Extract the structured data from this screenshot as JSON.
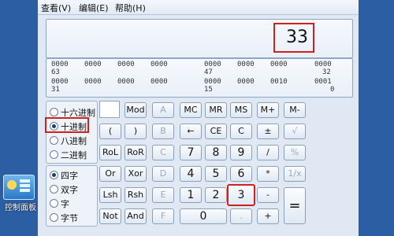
{
  "menu": {
    "view": "查看(V)",
    "edit": "编辑(E)",
    "help": "帮助(H)"
  },
  "display": {
    "value": "33"
  },
  "bits": {
    "r1": [
      "0000",
      "0000",
      "0000",
      "0000",
      "0000",
      "0000",
      "0000",
      "0000"
    ],
    "r2": [
      "63",
      "47",
      "32"
    ],
    "r3": [
      "0000",
      "0000",
      "0000",
      "0000",
      "0000",
      "0000",
      "0010",
      "0001"
    ],
    "r4": [
      "31",
      "15",
      "0"
    ]
  },
  "base": {
    "hex": "十六进制",
    "dec": "十进制",
    "oct": "八进制",
    "bin": "二进制",
    "selected": "dec"
  },
  "word": {
    "qword": "四字",
    "dword": "双字",
    "word": "字",
    "byte": "字节",
    "selected": "qword"
  },
  "buttons": {
    "mod": "Mod",
    "a": "A",
    "mc": "MC",
    "mr": "MR",
    "ms": "MS",
    "mplus": "M+",
    "mminus": "M-",
    "lparen": "(",
    "rparen": ")",
    "b": "B",
    "back": "←",
    "ce": "CE",
    "c": "C",
    "plusminus": "±",
    "sqrt": "√",
    "rol": "RoL",
    "ror": "RoR",
    "cc": "C",
    "n7": "7",
    "n8": "8",
    "n9": "9",
    "div": "/",
    "pct": "%",
    "or": "Or",
    "xor": "Xor",
    "d": "D",
    "n4": "4",
    "n5": "5",
    "n6": "6",
    "mul": "*",
    "recip": "1/x",
    "lsh": "Lsh",
    "rsh": "Rsh",
    "e": "E",
    "n1": "1",
    "n2": "2",
    "n3": "3",
    "sub": "-",
    "not": "Not",
    "and": "And",
    "f": "F",
    "n0": "0",
    "dot": ".",
    "add": "+",
    "eq": "="
  },
  "desktop": {
    "icon_label": "控制面板"
  }
}
